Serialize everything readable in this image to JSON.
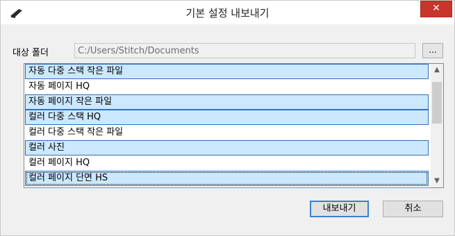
{
  "window": {
    "title": "기본 설정 내보내기",
    "close_label": "✕"
  },
  "folder": {
    "label": "대상 폴더",
    "path": "C:/Users/Stitch/Documents",
    "browse_label": "..."
  },
  "list": {
    "items": [
      {
        "label": "자동 다중 스택 작은 파일",
        "selected": true
      },
      {
        "label": "자동 페이지 HQ",
        "selected": false
      },
      {
        "label": "자동 페이지 작은 파일",
        "selected": true
      },
      {
        "label": "컬러 다중 스택 HQ",
        "selected": true
      },
      {
        "label": "컬러 다중 스택 작은 파일",
        "selected": false
      },
      {
        "label": "컬러 사진",
        "selected": true
      },
      {
        "label": "컬러 페이지 HQ",
        "selected": false
      },
      {
        "label": "컬러 페이지 단면 HS",
        "selected": true
      }
    ]
  },
  "buttons": {
    "export_label": "내보내기",
    "cancel_label": "취소"
  },
  "colors": {
    "selection": "#cce8ff",
    "selection_border": "#2e6fba",
    "close": "#c7352b"
  }
}
